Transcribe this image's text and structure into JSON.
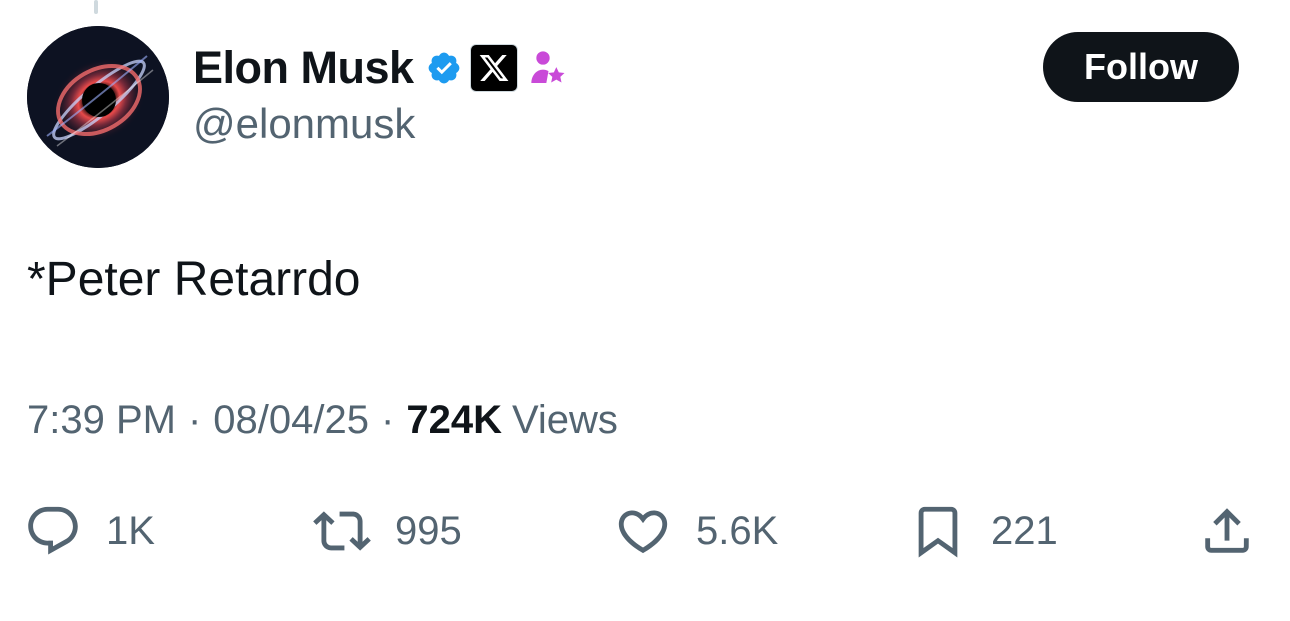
{
  "author": {
    "display_name": "Elon Musk",
    "handle": "@elonmusk",
    "avatar_icon": "black-hole-avatar",
    "verified_icon": "verified-badge-icon",
    "affiliate_icon": "x-logo-icon",
    "role_icon": "person-star-icon",
    "verified_color": "#1d9bf0",
    "role_color": "#c94ad8"
  },
  "follow_button": {
    "label": "Follow"
  },
  "tweet": {
    "text": "*Peter Retarrdo"
  },
  "meta": {
    "time": "7:39 PM",
    "separator": "·",
    "date": "08/04/25",
    "views_count": "724K",
    "views_label": "Views"
  },
  "actions": {
    "reply": {
      "icon": "reply-icon",
      "count": "1K"
    },
    "retweet": {
      "icon": "retweet-icon",
      "count": "995"
    },
    "like": {
      "icon": "heart-icon",
      "count": "5.6K"
    },
    "bookmark": {
      "icon": "bookmark-icon",
      "count": "221"
    },
    "share": {
      "icon": "share-icon"
    }
  },
  "colors": {
    "text_primary": "#0f1419",
    "text_secondary": "#536471",
    "button_bg": "#0f1419",
    "button_text": "#ffffff"
  }
}
